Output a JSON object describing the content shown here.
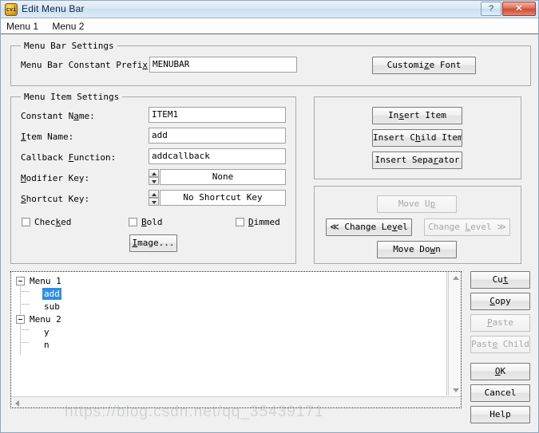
{
  "window": {
    "title": "Edit Menu Bar",
    "icon": "cvi-app-icon",
    "icon_text": "cvi",
    "help_button": "?",
    "close_button": "✕"
  },
  "menubar": {
    "items": [
      {
        "label": "Menu 1"
      },
      {
        "label": "Menu 2"
      }
    ]
  },
  "menu_bar_settings": {
    "title": "Menu Bar Settings",
    "prefix_label": "Menu Bar Constant Prefix:",
    "prefix_value": "MENUBAR",
    "prefix_placeholder": "",
    "customize_font_button": "Customize Font"
  },
  "menu_item_settings": {
    "title": "Menu Item Settings",
    "fields": [
      {
        "label": "Constant Name:",
        "value": "ITEM1"
      },
      {
        "label": "Item Name:",
        "value": "add"
      },
      {
        "label": "Callback Function:",
        "value": "addcallback"
      }
    ],
    "spinners": [
      {
        "label": "Modifier Key:",
        "value": "None"
      },
      {
        "label": "Shortcut Key:",
        "value": "No Shortcut Key"
      }
    ],
    "checkboxes": [
      {
        "label": "Checked",
        "checked": false
      },
      {
        "label": "Bold",
        "checked": false
      },
      {
        "label": "Dimmed",
        "checked": false
      }
    ],
    "image_button": "Image..."
  },
  "insert_panel": {
    "buttons": [
      {
        "label": "Insert Item",
        "enabled": true
      },
      {
        "label": "Insert Child Item",
        "enabled": true
      },
      {
        "label": "Insert Separator",
        "enabled": true
      }
    ]
  },
  "move_panel": {
    "buttons": [
      {
        "label": "Move Up",
        "enabled": false
      },
      {
        "label": "<< Change Level",
        "enabled": true
      },
      {
        "label": "Change Level >>",
        "enabled": false
      },
      {
        "label": "Move Down",
        "enabled": true
      }
    ]
  },
  "tree": {
    "nodes": [
      {
        "label": "Menu 1",
        "level": 0,
        "expanded": true,
        "selected": false
      },
      {
        "label": "add",
        "level": 1,
        "expanded": false,
        "selected": true
      },
      {
        "label": "sub",
        "level": 1,
        "expanded": false,
        "selected": false
      },
      {
        "label": "Menu 2",
        "level": 0,
        "expanded": true,
        "selected": false
      },
      {
        "label": "y",
        "level": 1,
        "expanded": false,
        "selected": false
      },
      {
        "label": "n",
        "level": 1,
        "expanded": false,
        "selected": false
      }
    ],
    "expander_glyph": "-"
  },
  "side_buttons": [
    {
      "label": "Cut",
      "enabled": true
    },
    {
      "label": "Copy",
      "enabled": true
    },
    {
      "label": "Paste",
      "enabled": false
    },
    {
      "label": "Paste Child",
      "enabled": false
    },
    {
      "label": "OK",
      "enabled": true
    },
    {
      "label": "Cancel",
      "enabled": true
    },
    {
      "label": "Help",
      "enabled": true
    }
  ],
  "watermark": "https://blog.csdn.net/qq_35439171",
  "colors": {
    "selection": "#2f8fe0",
    "panel": "#f0f0f0",
    "title_close": "#ce4a34"
  }
}
